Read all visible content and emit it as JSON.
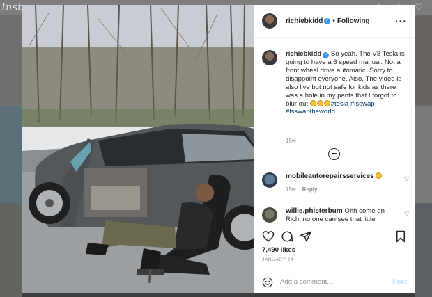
{
  "background": {
    "logo_text": "Insta"
  },
  "post": {
    "author": {
      "username": "richiebkidd",
      "verified": true
    },
    "follow_state": "Following",
    "caption": {
      "username": "richiebkidd",
      "text": "So yeah. The V8 Tesla is going to have a 6 speed manual. Not a front wheel drive automatic. Sorry to disappoint everyone. Also, The video is also live but not safe for kids as there was a hole in my pants that I forgot to blur out",
      "hashtags": [
        "#tesla",
        "#lsswap",
        "#lsswaptheworld"
      ],
      "time": "15w"
    },
    "comments": [
      {
        "username": "mobileautorepairsservices",
        "text": "",
        "time": "15w",
        "reply_label": "Reply"
      },
      {
        "username": "willie.phisterbum",
        "text": "Ohh come on Rich, no one can see that little",
        "time": "",
        "reply_label": ""
      }
    ],
    "likes_text": "7,490 likes",
    "date_text": "JANUARY 24",
    "add_comment_placeholder": "Add a comment...",
    "post_label": "Post"
  },
  "colors": {
    "link_blue": "#00376b",
    "verified_blue": "#3897f0",
    "post_disabled": "#b2dffc",
    "secondary_text": "#8e8e8e"
  },
  "icons": {
    "header": [
      "home-icon",
      "direct-icon",
      "explore-icon",
      "heart-icon"
    ],
    "actions": [
      "heart-icon",
      "comment-icon",
      "share-icon",
      "bookmark-icon"
    ]
  }
}
